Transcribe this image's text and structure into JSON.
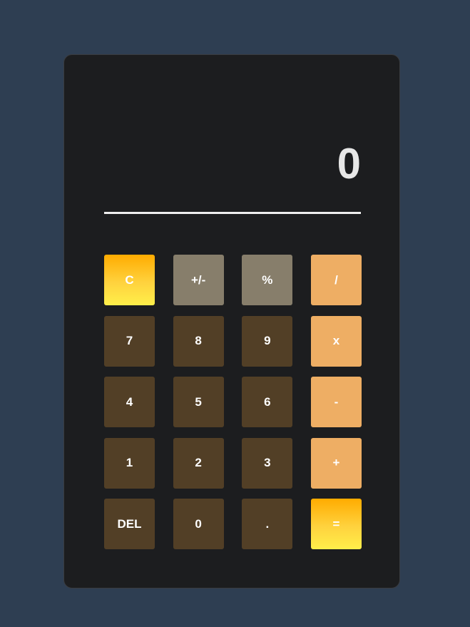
{
  "display": {
    "value": "0"
  },
  "keys": [
    {
      "label": "C",
      "name": "clear-button",
      "kind": "accent"
    },
    {
      "label": "+/-",
      "name": "toggle-sign-button",
      "kind": "func"
    },
    {
      "label": "%",
      "name": "percent-button",
      "kind": "func"
    },
    {
      "label": "/",
      "name": "divide-button",
      "kind": "op"
    },
    {
      "label": "7",
      "name": "digit-7-button",
      "kind": "num"
    },
    {
      "label": "8",
      "name": "digit-8-button",
      "kind": "num"
    },
    {
      "label": "9",
      "name": "digit-9-button",
      "kind": "num"
    },
    {
      "label": "x",
      "name": "multiply-button",
      "kind": "op"
    },
    {
      "label": "4",
      "name": "digit-4-button",
      "kind": "num"
    },
    {
      "label": "5",
      "name": "digit-5-button",
      "kind": "num"
    },
    {
      "label": "6",
      "name": "digit-6-button",
      "kind": "num"
    },
    {
      "label": "-",
      "name": "subtract-button",
      "kind": "op"
    },
    {
      "label": "1",
      "name": "digit-1-button",
      "kind": "num"
    },
    {
      "label": "2",
      "name": "digit-2-button",
      "kind": "num"
    },
    {
      "label": "3",
      "name": "digit-3-button",
      "kind": "num"
    },
    {
      "label": "+",
      "name": "add-button",
      "kind": "op"
    },
    {
      "label": "DEL",
      "name": "delete-button",
      "kind": "num"
    },
    {
      "label": "0",
      "name": "digit-0-button",
      "kind": "num"
    },
    {
      "label": ".",
      "name": "decimal-point-button",
      "kind": "num"
    },
    {
      "label": "=",
      "name": "equals-button",
      "kind": "accent"
    }
  ]
}
